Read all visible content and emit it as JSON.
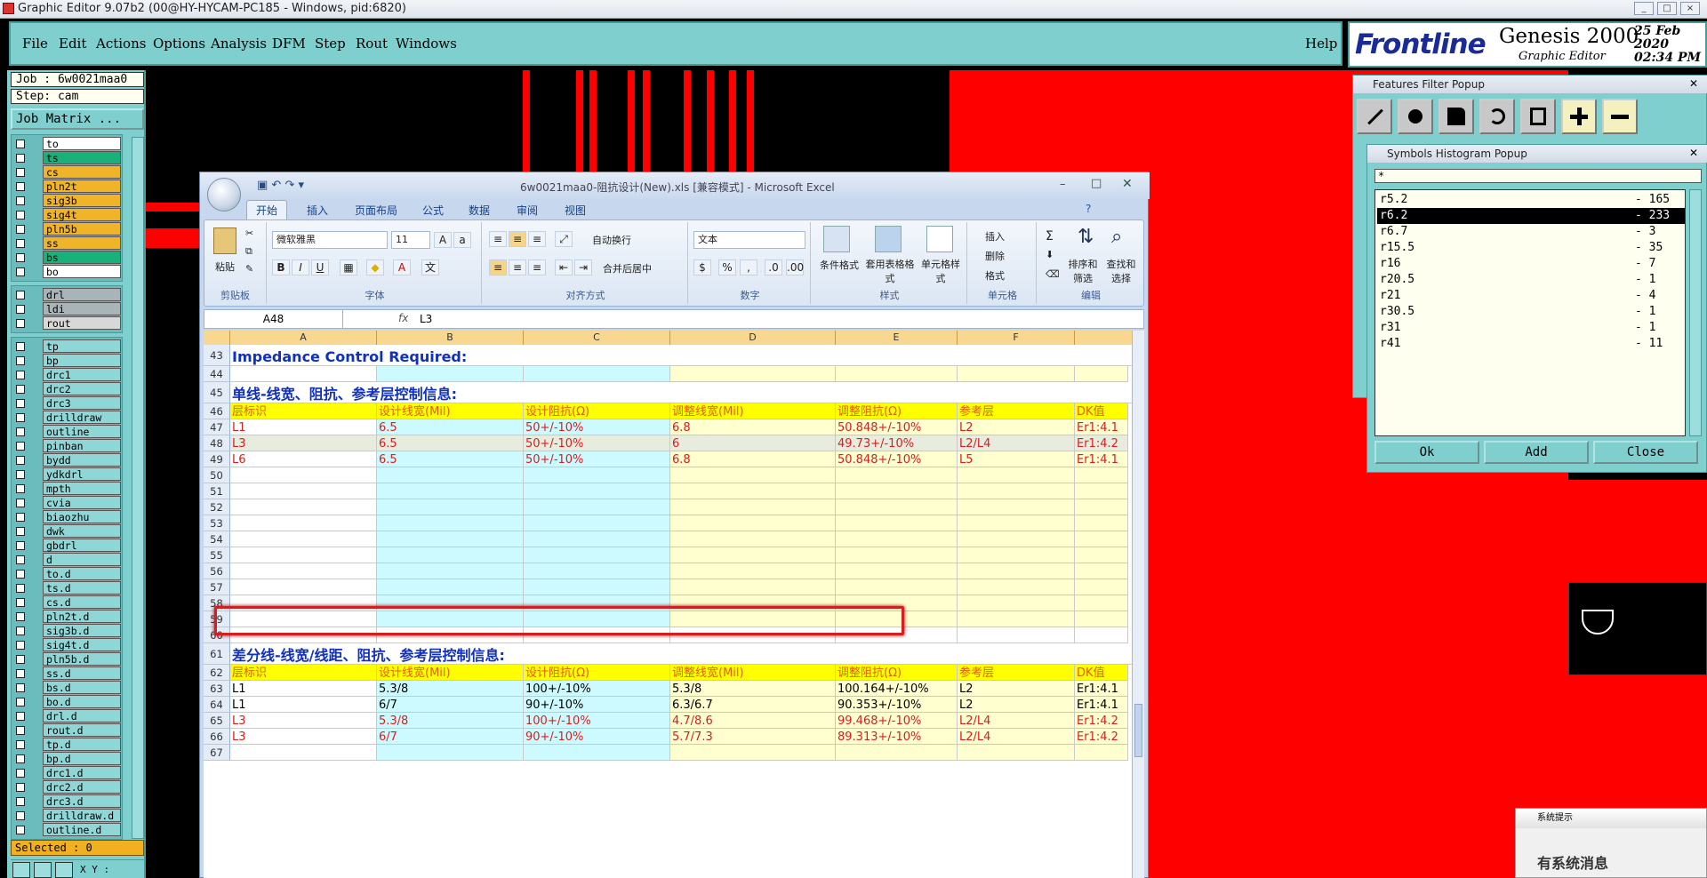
{
  "window_title": "Graphic Editor 9.07b2 (00@HY-HYCAM-PC185 - Windows, pid:6820)",
  "menu": [
    "File",
    "Edit",
    "Actions",
    "Options",
    "Analysis",
    "DFM",
    "Step",
    "Rout",
    "Windows"
  ],
  "menu_help": "Help",
  "logo": {
    "brand": "Frontline",
    "product": "Genesis 2000",
    "subtitle": "Graphic Editor",
    "date": "25 Feb 2020",
    "time": "02:34 PM"
  },
  "job_label": "Job : 6w0021maa0",
  "step_label": "Step: cam",
  "job_matrix_button": "Job Matrix ...",
  "layers_board": [
    {
      "name": "to",
      "color": "#ffffff"
    },
    {
      "name": "ts",
      "color": "#1ab07a"
    },
    {
      "name": "cs",
      "color": "#f0b428"
    },
    {
      "name": "pln2t",
      "color": "#f0b428"
    },
    {
      "name": "sig3b",
      "color": "#f0b428"
    },
    {
      "name": "sig4t",
      "color": "#f0b428"
    },
    {
      "name": "pln5b",
      "color": "#f0b428"
    },
    {
      "name": "ss",
      "color": "#f0b428"
    },
    {
      "name": "bs",
      "color": "#1ab07a"
    },
    {
      "name": "bo",
      "color": "#ffffff"
    }
  ],
  "layers_drill": [
    {
      "name": "drl",
      "color": "#a8b4b8"
    },
    {
      "name": "ldi",
      "color": "#a8b4b8"
    },
    {
      "name": "rout",
      "color": "#d8d8d8"
    }
  ],
  "layers_misc": [
    "tp",
    "bp",
    "drc1",
    "drc2",
    "drc3",
    "drilldraw",
    "outline",
    "pinban",
    "bydd",
    "ydkdrl",
    "mpth",
    "cvia",
    "biaozhu",
    "dwk",
    "gbdrl",
    "d",
    "to.d",
    "ts.d",
    "cs.d",
    "pln2t.d",
    "sig3b.d",
    "sig4t.d",
    "pln5b.d",
    "ss.d",
    "bs.d",
    "bo.d",
    "drl.d",
    "rout.d",
    "tp.d",
    "bp.d",
    "drc1.d",
    "drc2.d",
    "drc3.d",
    "drilldraw.d",
    "outline.d"
  ],
  "selected_label": "Selected : 0",
  "coord_label": "X Y :",
  "excel": {
    "title": "6w0021maa0-阻抗设计(New).xls  [兼容模式] - Microsoft Excel",
    "tabs": [
      "开始",
      "插入",
      "页面布局",
      "公式",
      "数据",
      "审阅",
      "视图"
    ],
    "groups": [
      "剪贴板",
      "字体",
      "对齐方式",
      "数字",
      "样式",
      "单元格",
      "编辑"
    ],
    "font_name": "微软雅黑",
    "font_size": "11",
    "number_format": "文本",
    "paste": "粘贴",
    "wrap": "自动换行",
    "merge": "合并后居中",
    "cond_format": "条件格式",
    "table_format": "套用表格格式",
    "cell_style": "单元格样式",
    "insert": "插入",
    "delete": "删除",
    "format": "格式",
    "sort": "排序和筛选",
    "find": "查找和选择",
    "name_box": "A48",
    "formula": "L3",
    "columns": [
      "A",
      "B",
      "C",
      "D",
      "E",
      "F"
    ],
    "rows": [
      {
        "n": "43",
        "type": "title",
        "a": "Impedance Control Required:"
      },
      {
        "n": "44",
        "type": "empty"
      },
      {
        "n": "45",
        "type": "title",
        "a": "单线-线宽、阻抗、参考层控制信息:"
      },
      {
        "n": "46",
        "type": "hdr",
        "cells": [
          "层标识",
          "设计线宽(Mil)",
          "设计阻抗(Ω)",
          "调整线宽(Mil)",
          "调整阻抗(Ω)",
          "参考层",
          "DK值"
        ]
      },
      {
        "n": "47",
        "type": "data",
        "color": "#d42020",
        "cells": [
          "L1",
          "6.5",
          "50+/-10%",
          "6.8",
          "50.848+/-10%",
          "L2",
          "Er1:4.1"
        ]
      },
      {
        "n": "48",
        "type": "data",
        "color": "#d42020",
        "sel": true,
        "cells": [
          "L3",
          "6.5",
          "50+/-10%",
          "6",
          "49.73+/-10%",
          "L2/L4",
          "Er1:4.2"
        ]
      },
      {
        "n": "49",
        "type": "data",
        "color": "#d42020",
        "cells": [
          "L6",
          "6.5",
          "50+/-10%",
          "6.8",
          "50.848+/-10%",
          "L5",
          "Er1:4.1"
        ]
      },
      {
        "n": "50",
        "type": "empty"
      },
      {
        "n": "51",
        "type": "empty"
      },
      {
        "n": "52",
        "type": "empty"
      },
      {
        "n": "53",
        "type": "empty"
      },
      {
        "n": "54",
        "type": "empty"
      },
      {
        "n": "55",
        "type": "empty"
      },
      {
        "n": "56",
        "type": "empty"
      },
      {
        "n": "57",
        "type": "empty"
      },
      {
        "n": "58",
        "type": "empty"
      },
      {
        "n": "59",
        "type": "empty"
      },
      {
        "n": "60",
        "type": "blank"
      },
      {
        "n": "61",
        "type": "title",
        "a": "差分线-线宽/线距、阻抗、参考层控制信息:"
      },
      {
        "n": "62",
        "type": "hdr",
        "cells": [
          "层标识",
          "设计线宽(Mil)",
          "设计阻抗(Ω)",
          "调整线宽(Mil)",
          "调整阻抗(Ω)",
          "参考层",
          "DK值"
        ]
      },
      {
        "n": "63",
        "type": "data",
        "color": "#000000",
        "cells": [
          "L1",
          "5.3/8",
          "100+/-10%",
          "5.3/8",
          "100.164+/-10%",
          "L2",
          "Er1:4.1"
        ]
      },
      {
        "n": "64",
        "type": "data",
        "color": "#000000",
        "cells": [
          "L1",
          "6/7",
          "90+/-10%",
          "6.3/6.7",
          "90.353+/-10%",
          "L2",
          "Er1:4.1"
        ]
      },
      {
        "n": "65",
        "type": "data",
        "color": "#d42020",
        "cells": [
          "L3",
          "5.3/8",
          "100+/-10%",
          "4.7/8.6",
          "99.468+/-10%",
          "L2/L4",
          "Er1:4.2"
        ]
      },
      {
        "n": "66",
        "type": "data",
        "color": "#d42020",
        "cells": [
          "L3",
          "6/7",
          "90+/-10%",
          "5.7/7.3",
          "89.313+/-10%",
          "L2/L4",
          "Er1:4.2"
        ]
      },
      {
        "n": "67",
        "type": "empty"
      }
    ]
  },
  "features_filter": {
    "title": "Features Filter Popup"
  },
  "symbols_hist": {
    "title": "Symbols Histogram Popup",
    "filter": "*",
    "items": [
      {
        "name": "r5.2",
        "count": "- 165"
      },
      {
        "name": "r6.2",
        "count": "- 233",
        "selected": true
      },
      {
        "name": "r6.7",
        "count": "- 3"
      },
      {
        "name": "r15.5",
        "count": "- 35"
      },
      {
        "name": "r16",
        "count": "- 7"
      },
      {
        "name": "r20.5",
        "count": "- 1"
      },
      {
        "name": "r21",
        "count": "- 4"
      },
      {
        "name": "r30.5",
        "count": "- 1"
      },
      {
        "name": "r31",
        "count": "- 1"
      },
      {
        "name": "r41",
        "count": "- 11"
      }
    ],
    "buttons": [
      "Ok",
      "Add",
      "Close"
    ]
  },
  "notification": {
    "title": "系统提示",
    "body": "有系统消息"
  }
}
